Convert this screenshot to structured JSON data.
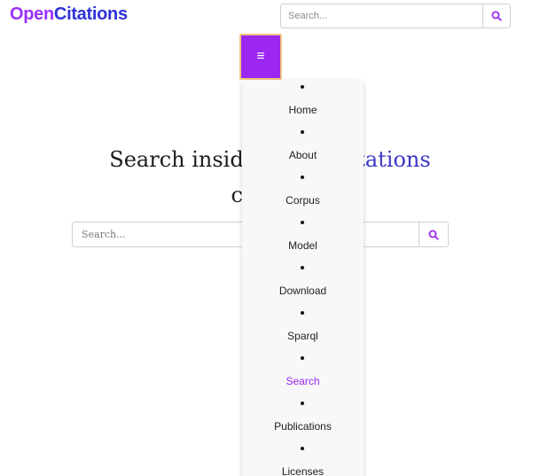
{
  "brand": {
    "part1": "Open",
    "part2": "Citations",
    "color_open": "#9931fc",
    "color_citations": "#2f32d6"
  },
  "header_search": {
    "placeholder": "Search...",
    "button_icon": "search-icon"
  },
  "menu_toggle": {
    "icon": "hamburger-icon",
    "symbol": "≡",
    "background": "#9b27f0"
  },
  "hero": {
    "line1_prefix": "Search inside t",
    "line1_brand": "tations",
    "line2": "co"
  },
  "main_search": {
    "placeholder": "Search...",
    "button_icon": "search-icon"
  },
  "nav_menu": {
    "items": [
      {
        "label": "Home",
        "active": false
      },
      {
        "label": "About",
        "active": false
      },
      {
        "label": "Corpus",
        "active": false
      },
      {
        "label": "Model",
        "active": false
      },
      {
        "label": "Download",
        "active": false
      },
      {
        "label": "Sparql",
        "active": false
      },
      {
        "label": "Search",
        "active": true
      },
      {
        "label": "Publications",
        "active": false
      },
      {
        "label": "Licenses",
        "active": false
      }
    ],
    "active_color": "#9b27f0"
  }
}
